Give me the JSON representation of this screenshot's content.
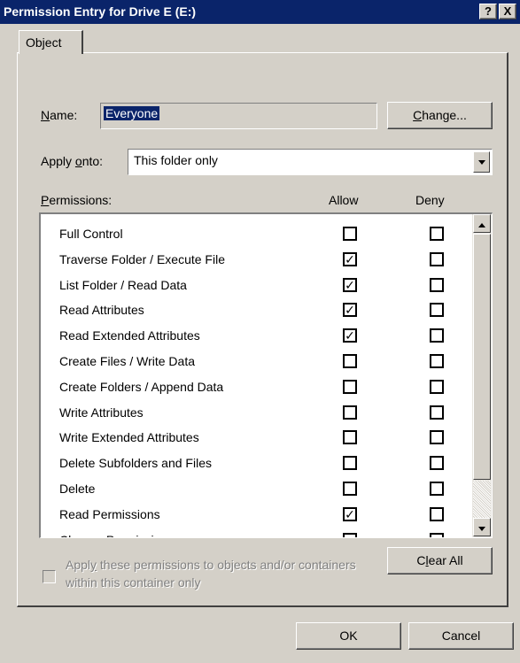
{
  "window": {
    "title": "Permission Entry for Drive E (E:)",
    "help_label": "?",
    "close_label": "X"
  },
  "tabs": [
    {
      "label": "Object"
    }
  ],
  "name": {
    "label_ul": "N",
    "label_rest": "ame:",
    "value": "Everyone",
    "change_ul": "C",
    "change_rest": "hange..."
  },
  "apply_onto": {
    "label_a": "Apply ",
    "label_ul": "o",
    "label_b": "nto:",
    "value": "This folder only"
  },
  "permissions": {
    "header_ul": "P",
    "header_rest": "ermissions:",
    "allow_header": "Allow",
    "deny_header": "Deny",
    "rows": [
      {
        "name": "Full Control",
        "allow": false,
        "deny": false
      },
      {
        "name": "Traverse Folder / Execute File",
        "allow": true,
        "deny": false
      },
      {
        "name": "List Folder / Read Data",
        "allow": true,
        "deny": false
      },
      {
        "name": "Read Attributes",
        "allow": true,
        "deny": false
      },
      {
        "name": "Read Extended Attributes",
        "allow": true,
        "deny": false
      },
      {
        "name": "Create Files / Write Data",
        "allow": false,
        "deny": false
      },
      {
        "name": "Create Folders / Append Data",
        "allow": false,
        "deny": false
      },
      {
        "name": "Write Attributes",
        "allow": false,
        "deny": false
      },
      {
        "name": "Write Extended Attributes",
        "allow": false,
        "deny": false
      },
      {
        "name": "Delete Subfolders and Files",
        "allow": false,
        "deny": false
      },
      {
        "name": "Delete",
        "allow": false,
        "deny": false
      },
      {
        "name": "Read Permissions",
        "allow": true,
        "deny": false
      },
      {
        "name": "Change Permissions",
        "allow": false,
        "deny": false
      }
    ]
  },
  "apply_these": {
    "text_a": "Appl",
    "text_ul": "y",
    "text_b": " these permissions to objects and/or containers within this container only",
    "checked": false,
    "enabled": false
  },
  "clear_all": {
    "ul": "l",
    "pre": "C",
    "post": "ear All"
  },
  "buttons": {
    "ok": "OK",
    "cancel": "Cancel"
  },
  "colors": {
    "titlebar": "#0a246a",
    "face": "#d4d0c8",
    "selection": "#0a246a"
  },
  "icons": {
    "check": "✓"
  }
}
